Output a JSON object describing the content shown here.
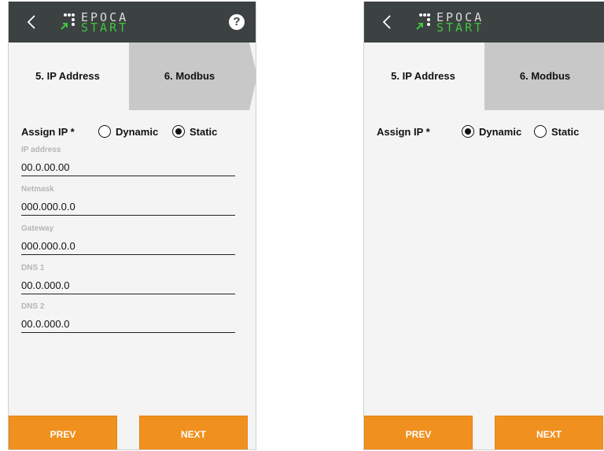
{
  "screens": [
    {
      "logo": {
        "top": "EPOCA",
        "bottom": "START"
      },
      "help_label": "?",
      "steps": {
        "current": "5. IP Address",
        "next": "6. Modbus"
      },
      "assign": {
        "label": "Assign IP *",
        "option_dynamic": "Dynamic",
        "option_static": "Static",
        "selected": "Static"
      },
      "fields": [
        {
          "label": "IP address",
          "value": "00.0.00.00"
        },
        {
          "label": "Netmask",
          "value": "000.000.0.0"
        },
        {
          "label": "Gateway",
          "value": "000.000.0.0"
        },
        {
          "label": "DNS 1",
          "value": "00.0.000.0"
        },
        {
          "label": "DNS 2",
          "value": "00.0.000.0"
        }
      ],
      "buttons": {
        "prev": "PREV",
        "next": "NEXT"
      }
    },
    {
      "logo": {
        "top": "EPOCA",
        "bottom": "START"
      },
      "steps": {
        "current": "5. IP Address",
        "next": "6. Modbus"
      },
      "assign": {
        "label": "Assign IP *",
        "option_dynamic": "Dynamic",
        "option_static": "Static",
        "selected": "Dynamic"
      },
      "buttons": {
        "prev": "PREV",
        "next": "NEXT"
      }
    }
  ],
  "colors": {
    "topbar": "#3c4141",
    "accent_orange": "#f0901e",
    "step_next_gray": "#c8c8c8",
    "logo_green": "#3dc73d"
  },
  "icons": [
    "chevron-left-icon",
    "logo-dots-icon",
    "help-icon",
    "radio-icon"
  ]
}
